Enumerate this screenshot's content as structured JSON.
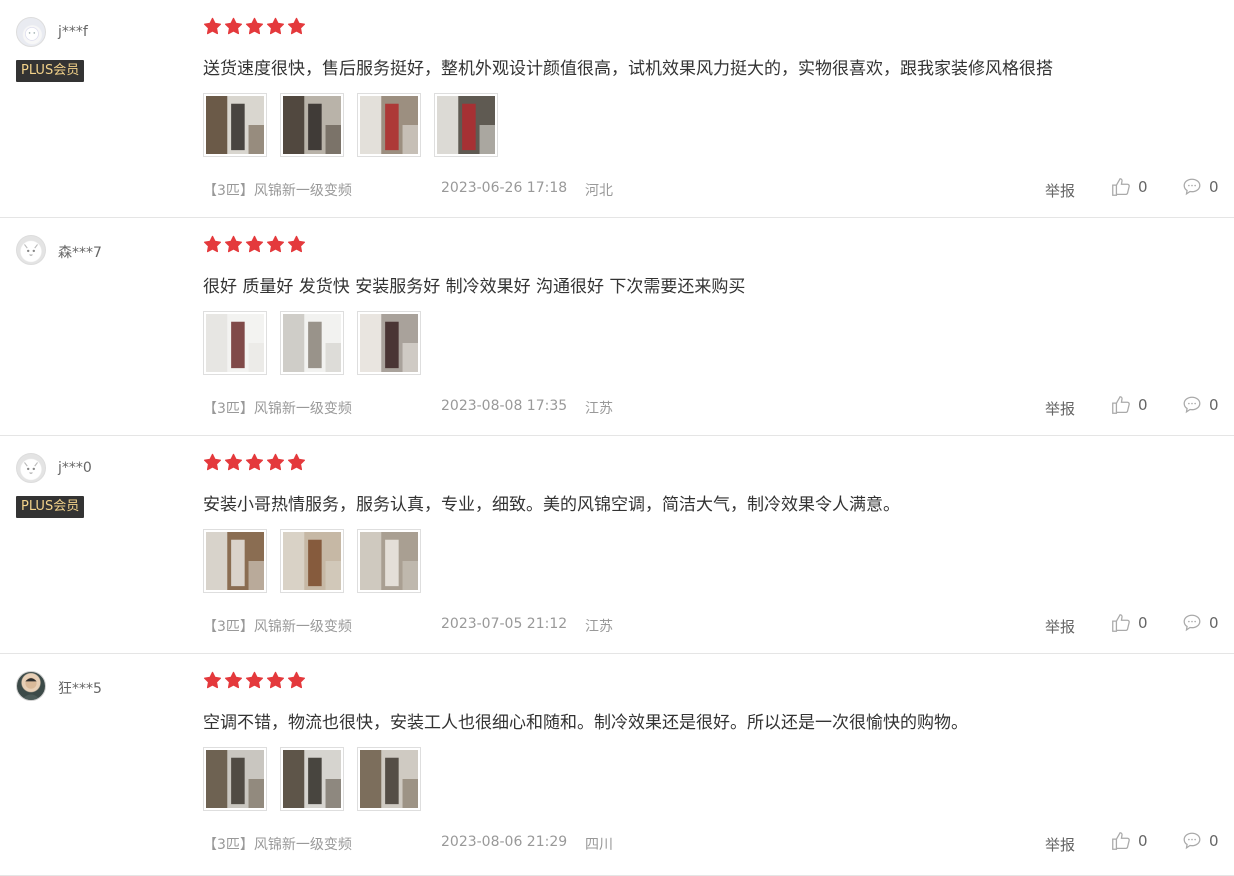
{
  "colors": {
    "star": "#e4393c",
    "badge_bg": "#333333",
    "badge_text": "#f2d28a",
    "meta_text": "#999999",
    "divider": "#e5e5e5"
  },
  "reviews": [
    {
      "username": "j***f",
      "avatar_icon": "user-avatar-icon",
      "badge": "PLUS会员",
      "rating": 5,
      "text": "送货速度很快，售后服务挺好，整机外观设计颜值很高，试机效果风力挺大的，实物很喜欢，跟我家装修风格很搭",
      "photos": [
        {
          "colors": [
            "#6b5a48",
            "#d9d6cf",
            "#2e2a27"
          ]
        },
        {
          "colors": [
            "#51483f",
            "#b9b3a9",
            "#2a2623"
          ]
        },
        {
          "colors": [
            "#e3e0da",
            "#9c8f80",
            "#b02a2a"
          ]
        },
        {
          "colors": [
            "#dcdad5",
            "#5f5a52",
            "#b32a2f"
          ]
        }
      ],
      "product": "【3匹】风锦新一级变频",
      "date": "2023-06-26 17:18",
      "region": "河北",
      "report": "举报",
      "likes": "0",
      "replies": "0"
    },
    {
      "username": "森***7",
      "avatar_icon": "cat-avatar-icon",
      "badge": "",
      "rating": 5,
      "text": "很好 质量好 发货快 安装服务好 制冷效果好 沟通很好 下次需要还来购买",
      "photos": [
        {
          "colors": [
            "#e7e6e3",
            "#f3f3f1",
            "#6b2c2c"
          ]
        },
        {
          "colors": [
            "#cfcdc8",
            "#f2f2f0",
            "#8a8378"
          ]
        },
        {
          "colors": [
            "#e9e5e0",
            "#a9a29b",
            "#3a2222"
          ]
        }
      ],
      "product": "【3匹】风锦新一级变频",
      "date": "2023-08-08 17:35",
      "region": "江苏",
      "report": "举报",
      "likes": "0",
      "replies": "0"
    },
    {
      "username": "j***0",
      "avatar_icon": "cat-avatar-icon",
      "badge": "PLUS会员",
      "rating": 5,
      "text": "安装小哥热情服务，服务认真，专业，细致。美的风锦空调，简洁大气，制冷效果令人满意。",
      "photos": [
        {
          "colors": [
            "#d8d3cb",
            "#8a6d52",
            "#e7e5e1"
          ]
        },
        {
          "colors": [
            "#d9d2c6",
            "#c6b8a5",
            "#7a4a2a"
          ]
        },
        {
          "colors": [
            "#cfc9bf",
            "#a99f92",
            "#eeeae4"
          ]
        }
      ],
      "product": "【3匹】风锦新一级变频",
      "date": "2023-07-05 21:12",
      "region": "江苏",
      "report": "举报",
      "likes": "0",
      "replies": "0"
    },
    {
      "username": "狂***5",
      "avatar_icon": "person-avatar-icon",
      "badge": "",
      "rating": 5,
      "text": "空调不错，物流也很快，安装工人也很细心和随和。制冷效果还是很好。所以还是一次很愉快的购物。",
      "photos": [
        {
          "colors": [
            "#6e6252",
            "#c9c6c0",
            "#3b352e"
          ]
        },
        {
          "colors": [
            "#5e5549",
            "#d6d4cf",
            "#2f2b26"
          ]
        },
        {
          "colors": [
            "#7c6e5c",
            "#cfcac2",
            "#3f3830"
          ]
        }
      ],
      "product": "【3匹】风锦新一级变频",
      "date": "2023-08-06 21:29",
      "region": "四川",
      "report": "举报",
      "likes": "0",
      "replies": "0"
    }
  ]
}
